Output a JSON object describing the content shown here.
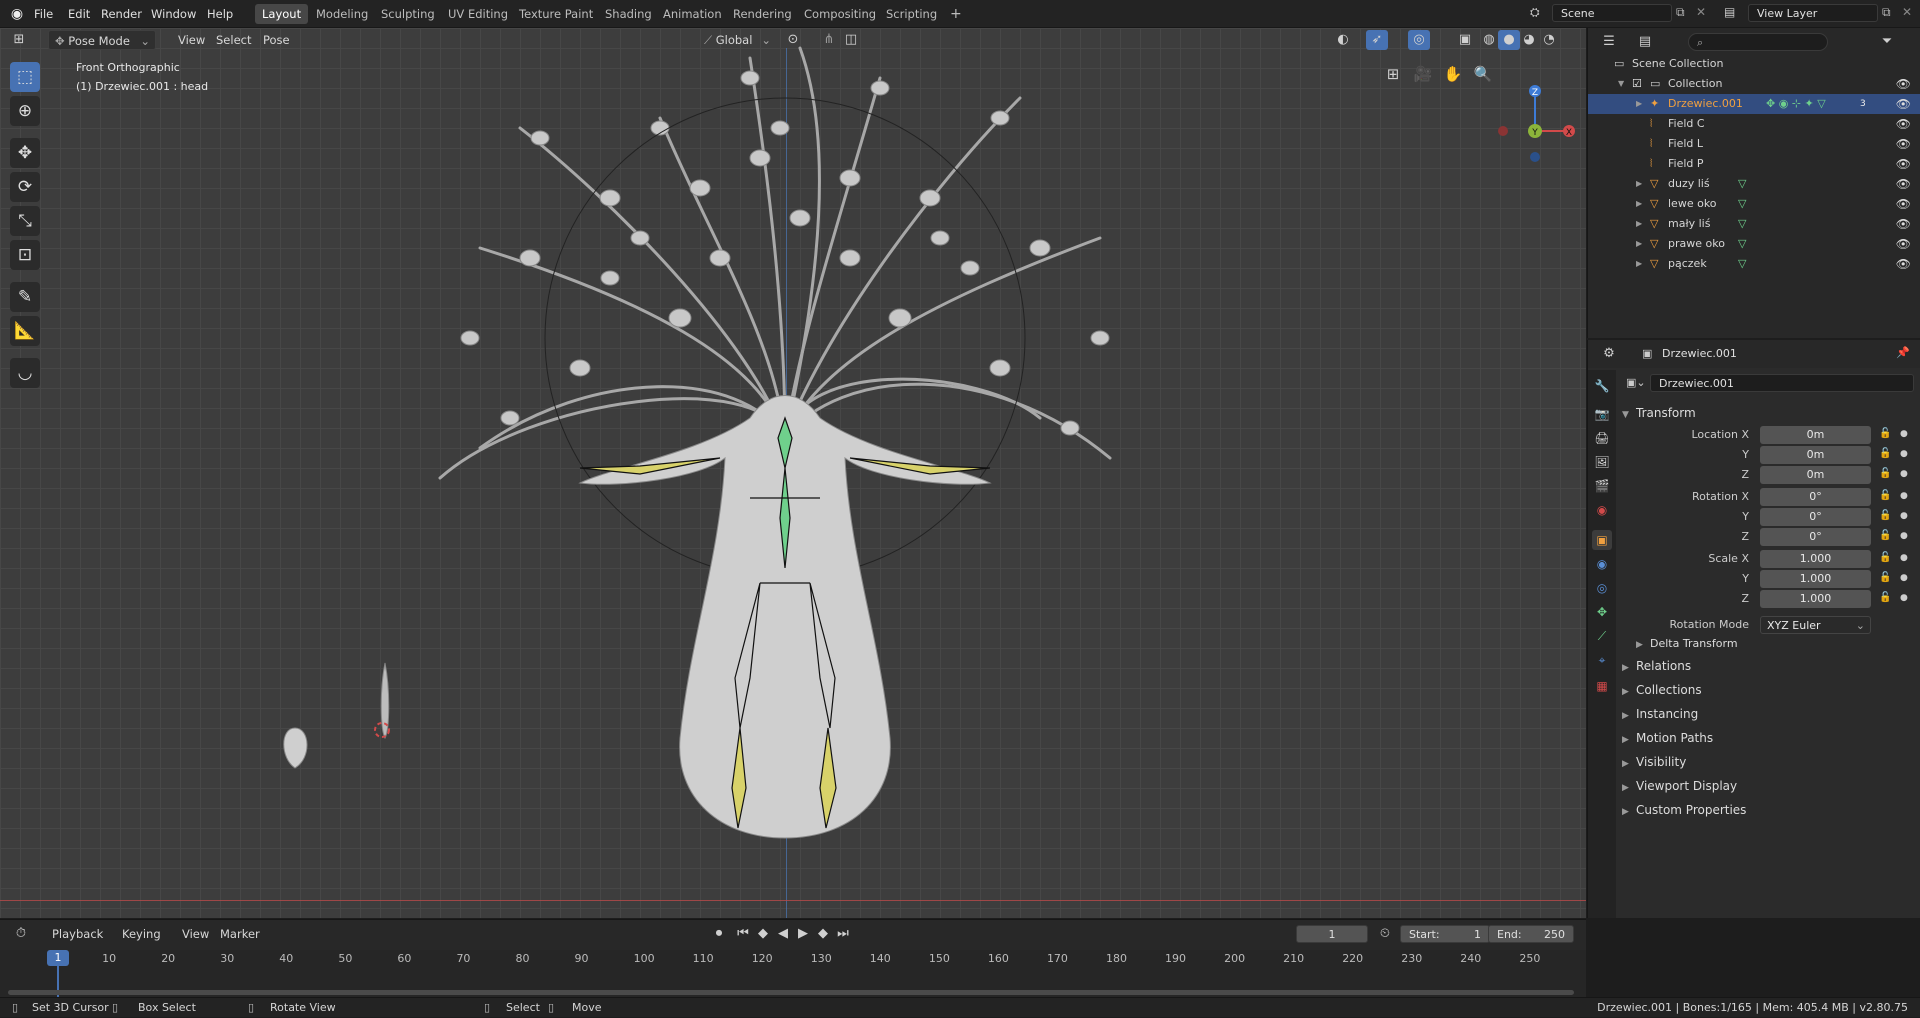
{
  "topbar": {
    "menus": [
      "File",
      "Edit",
      "Render",
      "Window",
      "Help"
    ],
    "workspaces": [
      "Layout",
      "Modeling",
      "Sculpting",
      "UV Editing",
      "Texture Paint",
      "Shading",
      "Animation",
      "Rendering",
      "Compositing",
      "Scripting"
    ],
    "active_workspace": "Layout",
    "add_tab": "+",
    "scene": "Scene",
    "view_layer": "View Layer"
  },
  "viewport": {
    "mode": "Pose Mode",
    "menus": [
      "View",
      "Select",
      "Pose"
    ],
    "orientation": "Global",
    "view_name": "Front Orthographic",
    "object_info": "(1) Drzewiec.001 : head",
    "gizmo": {
      "z": "Z",
      "y": "Y",
      "x": "X"
    }
  },
  "outliner": {
    "search_placeholder": "",
    "root": "Scene Collection",
    "collection": "Collection",
    "items": [
      {
        "name": "Drzewiec.001",
        "type": "armature",
        "active": true
      },
      {
        "name": "Field C",
        "type": "field"
      },
      {
        "name": "Field L",
        "type": "field"
      },
      {
        "name": "Field P",
        "type": "field"
      },
      {
        "name": "duzy liś",
        "type": "mesh"
      },
      {
        "name": "lewe oko",
        "type": "mesh"
      },
      {
        "name": "mały liś",
        "type": "mesh"
      },
      {
        "name": "prawe oko",
        "type": "mesh"
      },
      {
        "name": "pączek",
        "type": "mesh"
      }
    ],
    "badge_count": "3"
  },
  "properties": {
    "header_object": "Drzewiec.001",
    "object_name": "Drzewiec.001",
    "transform_title": "Transform",
    "location": {
      "label": "Location X",
      "x": "0m",
      "y": "0m",
      "z": "0m"
    },
    "rotation": {
      "label": "Rotation X",
      "x": "0°",
      "y": "0°",
      "z": "0°"
    },
    "scale": {
      "label": "Scale X",
      "x": "1.000",
      "y": "1.000",
      "z": "1.000"
    },
    "axis_y": "Y",
    "axis_z": "Z",
    "rotation_mode_label": "Rotation Mode",
    "rotation_mode": "XYZ Euler",
    "delta": "Delta Transform",
    "panels": [
      "Relations",
      "Collections",
      "Instancing",
      "Motion Paths",
      "Visibility",
      "Viewport Display",
      "Custom Properties"
    ]
  },
  "timeline": {
    "menus": [
      "Playback",
      "Keying",
      "View",
      "Marker"
    ],
    "current_frame": "1",
    "start_label": "Start:",
    "start": "1",
    "end_label": "End:",
    "end": "250",
    "ticks": [
      "1",
      "10",
      "20",
      "30",
      "40",
      "50",
      "60",
      "70",
      "80",
      "90",
      "100",
      "110",
      "120",
      "130",
      "140",
      "150",
      "160",
      "170",
      "180",
      "190",
      "200",
      "210",
      "220",
      "230",
      "240",
      "250"
    ]
  },
  "statusbar": {
    "left": [
      "Set 3D Cursor",
      "Box Select",
      "Rotate View",
      "Select",
      "Move"
    ],
    "right": "Drzewiec.001 | Bones:1/165 | Mem: 405.4 MB | v2.80.75"
  },
  "colors": {
    "accent": "#4772b3",
    "active_object": "#f0a040",
    "bone_green": "#6fd08c",
    "bone_yellow": "#d8d26a"
  }
}
